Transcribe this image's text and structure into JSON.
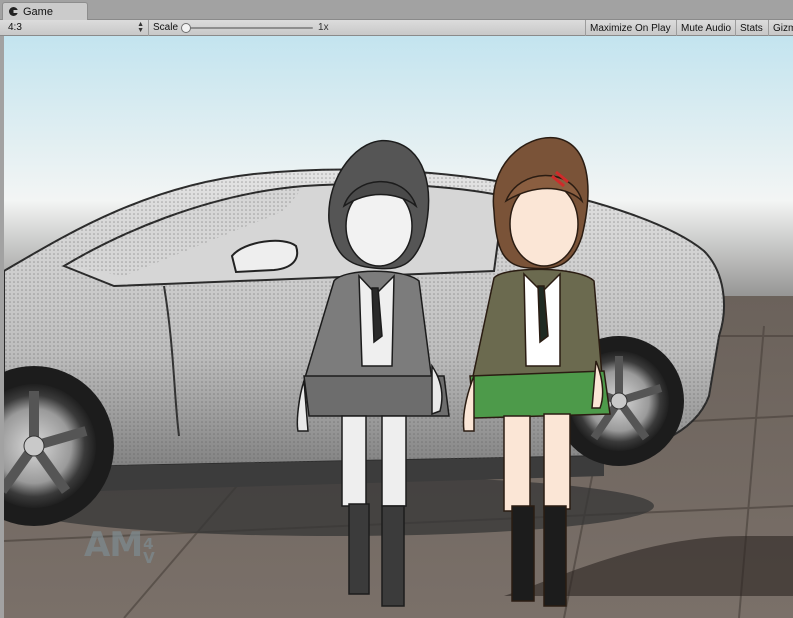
{
  "window": {
    "tab_label": "Game",
    "tab_icon": "game-controller-icon"
  },
  "toolbar": {
    "aspect_label": "4:3",
    "scale_label": "Scale",
    "scale_value": "1x",
    "scale_fraction": 0.0,
    "maximize_label": "Maximize On Play",
    "mute_label": "Mute Audio",
    "stats_label": "Stats",
    "gizmos_label": "Gizmos"
  },
  "scene": {
    "watermark_text": "AM",
    "watermark_sub_top": "4",
    "watermark_sub_bottom": "V"
  }
}
